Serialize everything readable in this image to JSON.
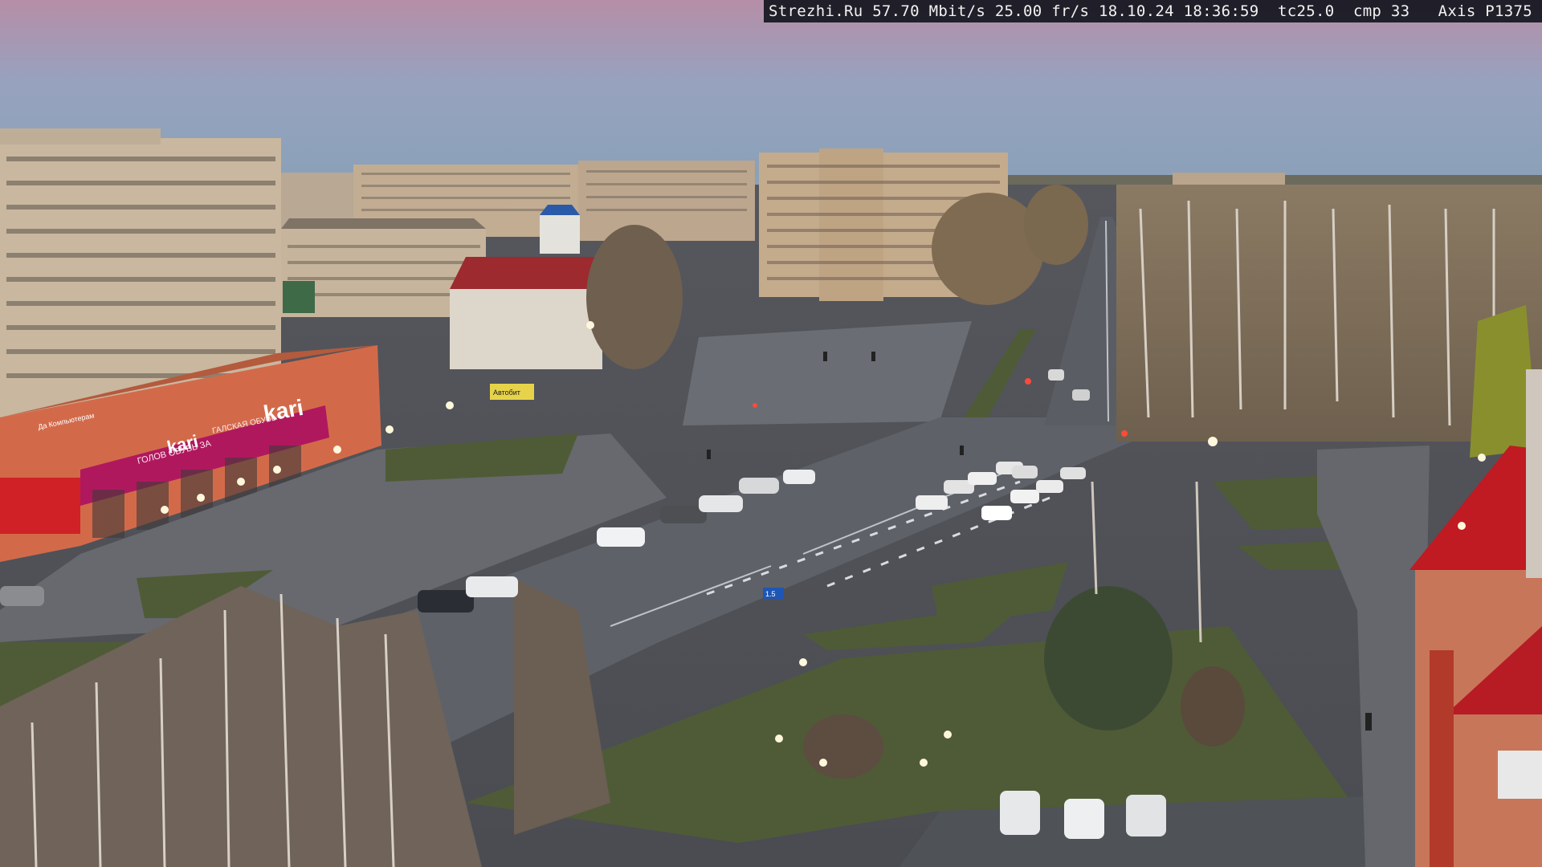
{
  "overlay": {
    "site": "Strezhi.Ru",
    "bitrate": "57.70 Mbit/s",
    "fps": "25.00 fr/s",
    "date": "18.10.24",
    "time": "18:36:59",
    "tc": "tc25.0",
    "cmp": "cmp 33",
    "camera": "Axis P1375"
  },
  "signs": {
    "store_brand": "kari",
    "store_brand_2": "kari",
    "store_tagline": "ГОЛОВ ОБУВЬ ЗА",
    "store_sign_small": "ГАЛСКАЯ ОБУВЬ",
    "shop_left_sign": "Да Компьютерам",
    "shop_center_sign": "Автобит",
    "road_sign": "1.5"
  },
  "colors": {
    "sky_top": "#b98fa6",
    "sky_bottom": "#8fa8c2",
    "road": "#5b5f66",
    "grass": "#4d5a33",
    "kari_magenta": "#b0185e",
    "tower_red": "#c01a22"
  }
}
